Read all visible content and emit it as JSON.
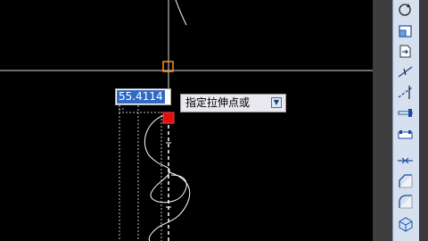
{
  "canvas": {
    "background": "#000000"
  },
  "dynamic_input": {
    "value": "55.4114"
  },
  "command_prompt": {
    "text": "指定拉伸点或",
    "options_icon": "down-arrow-options-icon"
  },
  "toolbar": {
    "name": "modify-toolbar",
    "tools": [
      {
        "name": "rotate-tool",
        "icon": "rotate-icon"
      },
      {
        "name": "scale-tool",
        "icon": "scale-icon"
      },
      {
        "name": "stretch-tool",
        "icon": "stretch-icon"
      },
      {
        "name": "trim-tool",
        "icon": "trim-icon"
      },
      {
        "name": "extend-tool",
        "icon": "extend-icon"
      },
      {
        "name": "break-at-point-tool",
        "icon": "break-at-point-icon"
      },
      {
        "name": "break-tool",
        "icon": "break-icon"
      },
      {
        "name": "join-tool",
        "icon": "join-icon"
      },
      {
        "name": "chamfer-tool",
        "icon": "chamfer-icon"
      },
      {
        "name": "fillet-tool",
        "icon": "fillet-icon"
      },
      {
        "name": "explode-tool",
        "icon": "explode-icon"
      }
    ]
  }
}
